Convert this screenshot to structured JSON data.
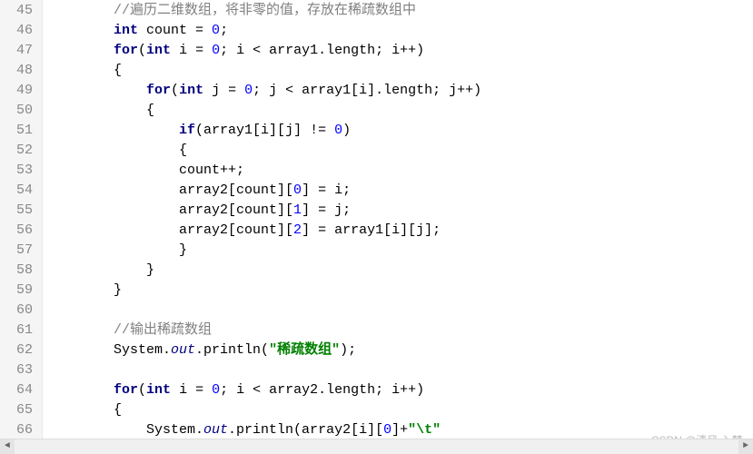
{
  "gutter": {
    "start": 45,
    "end": 66
  },
  "lines": {
    "l45": [
      [
        "        ",
        "id"
      ],
      [
        "//遍历二维数组，将非零的值，存放在稀疏数组中",
        "cmt"
      ]
    ],
    "l46": [
      [
        "        ",
        "id"
      ],
      [
        "int",
        "kw"
      ],
      [
        " count = ",
        "id"
      ],
      [
        "0",
        "num"
      ],
      [
        ";",
        "id"
      ]
    ],
    "l47": [
      [
        "        ",
        "id"
      ],
      [
        "for",
        "kw"
      ],
      [
        "(",
        "id"
      ],
      [
        "int",
        "kw"
      ],
      [
        " i = ",
        "id"
      ],
      [
        "0",
        "num"
      ],
      [
        "; i < array1.",
        "id"
      ],
      [
        "length",
        "mth"
      ],
      [
        "; i++)",
        "id"
      ]
    ],
    "l48": [
      [
        "        {",
        "id"
      ]
    ],
    "l49": [
      [
        "            ",
        "id"
      ],
      [
        "for",
        "kw"
      ],
      [
        "(",
        "id"
      ],
      [
        "int",
        "kw"
      ],
      [
        " j = ",
        "id"
      ],
      [
        "0",
        "num"
      ],
      [
        "; j < array1[i].",
        "id"
      ],
      [
        "length",
        "mth"
      ],
      [
        "; j++)",
        "id"
      ]
    ],
    "l50": [
      [
        "            {",
        "id"
      ]
    ],
    "l51": [
      [
        "                ",
        "id"
      ],
      [
        "if",
        "kw"
      ],
      [
        "(array1[i][j] != ",
        "id"
      ],
      [
        "0",
        "num"
      ],
      [
        ")",
        "id"
      ]
    ],
    "l52": [
      [
        "                {",
        "id"
      ]
    ],
    "l53": [
      [
        "                count++;",
        "id"
      ]
    ],
    "l54": [
      [
        "                array2[count][",
        "id"
      ],
      [
        "0",
        "num"
      ],
      [
        "] = i;",
        "id"
      ]
    ],
    "l55": [
      [
        "                array2[count][",
        "id"
      ],
      [
        "1",
        "num"
      ],
      [
        "] = j;",
        "id"
      ]
    ],
    "l56": [
      [
        "                array2[count][",
        "id"
      ],
      [
        "2",
        "num"
      ],
      [
        "] = array1[i][j];",
        "id"
      ]
    ],
    "l57": [
      [
        "                }",
        "id"
      ]
    ],
    "l58": [
      [
        "            }",
        "id"
      ]
    ],
    "l59": [
      [
        "        }",
        "id"
      ]
    ],
    "l60": [
      [
        "",
        "id"
      ]
    ],
    "l61": [
      [
        "        ",
        "id"
      ],
      [
        "//输出稀疏数组",
        "cmt"
      ]
    ],
    "l62": [
      [
        "        System.",
        "id"
      ],
      [
        "out",
        "st"
      ],
      [
        ".println(",
        "id"
      ],
      [
        "\"稀疏数组\"",
        "str"
      ],
      [
        ");",
        "id"
      ]
    ],
    "l63": [
      [
        "",
        "id"
      ]
    ],
    "l64": [
      [
        "        ",
        "id"
      ],
      [
        "for",
        "kw"
      ],
      [
        "(",
        "id"
      ],
      [
        "int",
        "kw"
      ],
      [
        " i = ",
        "id"
      ],
      [
        "0",
        "num"
      ],
      [
        "; i < array2.",
        "id"
      ],
      [
        "length",
        "mth"
      ],
      [
        "; i++)",
        "id"
      ]
    ],
    "l65": [
      [
        "        {",
        "id"
      ]
    ],
    "l66": [
      [
        "            System.",
        "id"
      ],
      [
        "out",
        "st"
      ],
      [
        ".println(array2[i][",
        "id"
      ],
      [
        "0",
        "num"
      ],
      [
        "]+",
        "id"
      ],
      [
        "\"\\t\"",
        "str"
      ]
    ]
  },
  "watermark": "CSDN @清风,入梦.",
  "scroll": {
    "left_arrow": "◄",
    "right_arrow": "►"
  }
}
